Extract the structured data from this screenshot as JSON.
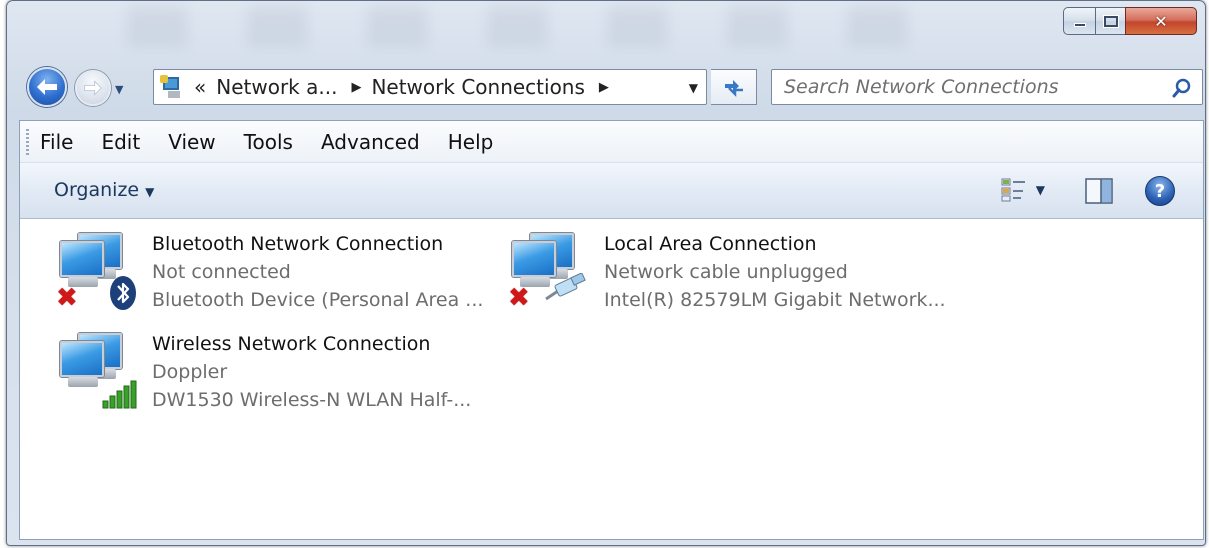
{
  "window": {
    "caption": {
      "minimize": "—",
      "maximize": "▢",
      "close": "✕"
    }
  },
  "navigation": {
    "address": {
      "overflow": "«",
      "parts": [
        "Network a...",
        "Network Connections"
      ]
    },
    "search": {
      "placeholder": "Search Network Connections"
    }
  },
  "menubar": {
    "items": [
      "File",
      "Edit",
      "View",
      "Tools",
      "Advanced",
      "Help"
    ]
  },
  "toolbar": {
    "organize_label": "Organize",
    "help_label": "?"
  },
  "connections": [
    {
      "name": "Bluetooth Network Connection",
      "status": "Not connected",
      "device": "Bluetooth Device (Personal Area ...",
      "badge": "bluetooth-icon",
      "error": true
    },
    {
      "name": "Local Area Connection",
      "status": "Network cable unplugged",
      "device": "Intel(R) 82579LM Gigabit Network...",
      "badge": "ethernet-cable-icon",
      "error": true
    },
    {
      "name": "Wireless Network Connection",
      "status": "Doppler",
      "device": "DW1530 Wireless-N WLAN Half-...",
      "badge": "signal-strength-icon",
      "error": false
    }
  ],
  "colors": {
    "accent": "#2f6fd0",
    "error_red": "#d01818",
    "signal_green": "#3aa02c",
    "secondary_text": "#6d6d6d"
  }
}
